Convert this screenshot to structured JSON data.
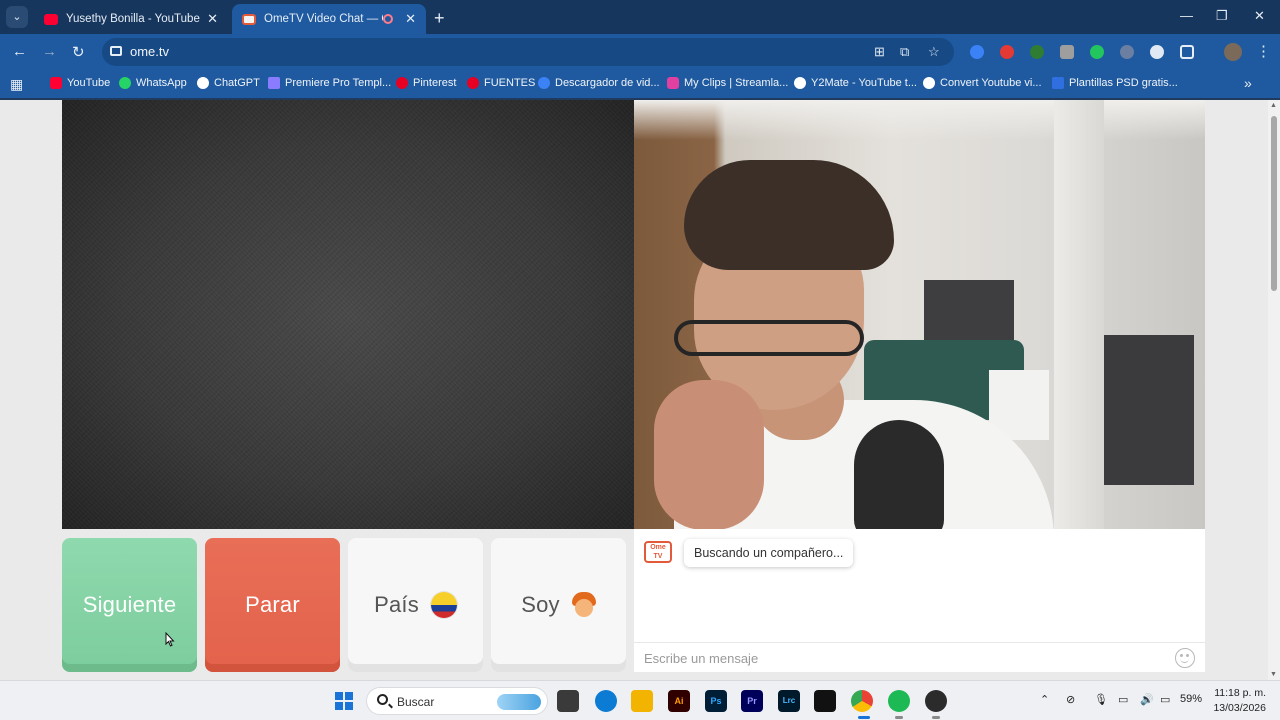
{
  "browser": {
    "tabs": [
      {
        "title": "Yusethy Bonilla - YouTube",
        "favicon_color": "#ff0033"
      },
      {
        "title": "OmeTV Video Chat — Ome",
        "favicon_color": "#e25a3a"
      }
    ],
    "new_tab_symbol": "+",
    "window_controls": {
      "minimize": "—",
      "restore": "❐",
      "close": "✕"
    },
    "url": "ome.tv",
    "bookmarks": [
      {
        "label": "YouTube",
        "icon_color": "#ff0033"
      },
      {
        "label": "WhatsApp",
        "icon_color": "#25d366"
      },
      {
        "label": "ChatGPT",
        "icon_color": "#ffffff"
      },
      {
        "label": "Premiere Pro Templ...",
        "icon_color": "#8a7cff"
      },
      {
        "label": "Pinterest",
        "icon_color": "#e60023"
      },
      {
        "label": "FUENTES",
        "icon_color": "#e60023"
      },
      {
        "label": "Descargador de vid...",
        "icon_color": "#3b82f6"
      },
      {
        "label": "My Clips | Streamla...",
        "icon_color": "#e040a0"
      },
      {
        "label": "Y2Mate - YouTube t...",
        "icon_color": "#ffffff"
      },
      {
        "label": "Convert Youtube vi...",
        "icon_color": "#ffffff"
      },
      {
        "label": "Plantillas PSD gratis...",
        "icon_color": "#2f6fe0"
      }
    ]
  },
  "ometv": {
    "buttons": {
      "next": "Siguiente",
      "stop": "Parar",
      "country": "País",
      "gender": "Soy"
    },
    "colors": {
      "next": "#86d4a5",
      "stop": "#e6674f"
    },
    "logo_text": "Ome TV",
    "status_message": "Buscando un compañero...",
    "message_placeholder": "Escribe un mensaje"
  },
  "taskbar": {
    "search_label": "Buscar",
    "apps": [
      "Ai",
      "Ps",
      "Pr",
      "Lrc"
    ],
    "battery": "59%",
    "time": "11:18 p. m.",
    "date": "13/03/2026"
  }
}
